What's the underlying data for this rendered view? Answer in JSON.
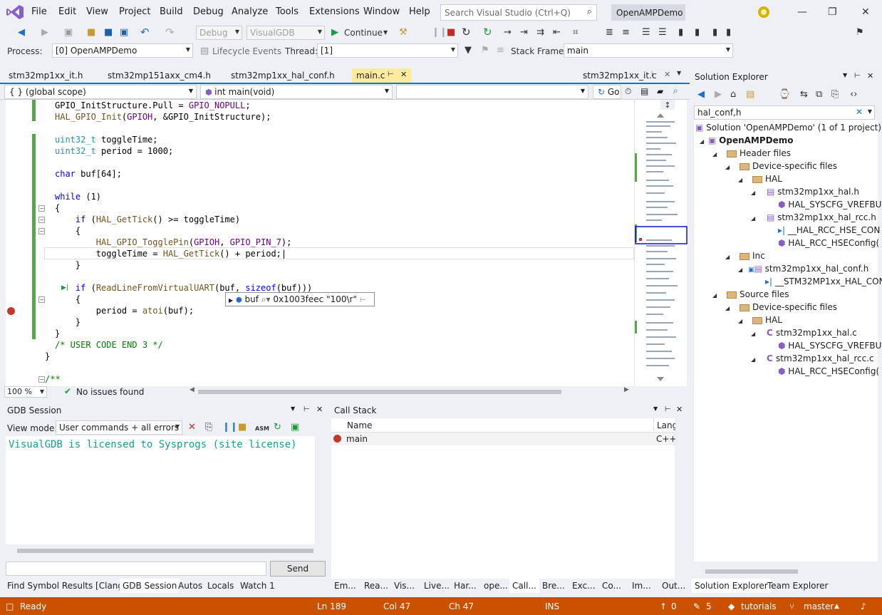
{
  "menu": {
    "items": [
      "File",
      "Edit",
      "View",
      "Project",
      "Build",
      "Debug",
      "Analyze",
      "Tools",
      "Extensions",
      "Window",
      "Help"
    ],
    "search_placeholder": "Search Visual Studio (Ctrl+Q)",
    "project_title": "OpenAMPDemo"
  },
  "toolbar": {
    "config": "Debug",
    "platform": "VisualGDB",
    "continue_label": "Continue",
    "process_label": "Process:",
    "process_value": "[0] OpenAMPDemo",
    "lifecycle_label": "Lifecycle Events",
    "thread_label": "Thread:",
    "thread_value": "[1]",
    "stackframe_label": "Stack Frame:",
    "stackframe_value": "main"
  },
  "editor": {
    "tabs": [
      "stm32mp1xx_it.h",
      "stm32mp151axx_cm4.h",
      "stm32mp1xx_hal_conf.h",
      "main.c",
      "stm32mp1xx_it.c"
    ],
    "active_tab": "main.c",
    "scope": "{ } (global scope)",
    "function": "int main(void)",
    "go_label": "Go",
    "zoom": "100 %",
    "issues": "No issues found",
    "datatip": {
      "name": "buf",
      "value": "0x1003feec \"100\\r\""
    }
  },
  "gdb": {
    "title": "GDB Session",
    "view_mode_label": "View mode:",
    "view_mode_value": "User commands + all errors",
    "output": "VisualGDB is licensed to Sysprogs (site license)",
    "send_label": "Send"
  },
  "bottom_left_tabs": [
    "Find Symbol Results [Clang]",
    "GDB Session",
    "Autos",
    "Locals",
    "Watch 1"
  ],
  "callstack": {
    "title": "Call Stack",
    "col_name": "Name",
    "col_lang": "Lang",
    "rows": [
      {
        "name": "main",
        "lang": "C++..."
      }
    ]
  },
  "bottom_right_tabs": [
    "Em...",
    "Rea...",
    "Vis...",
    "Live...",
    "Har...",
    "ope...",
    "Call...",
    "Bre...",
    "Exc...",
    "Co...",
    "Im...",
    "Out..."
  ],
  "solution_explorer": {
    "title": "Solution Explorer",
    "search_value": "hal_conf,h",
    "tabs": [
      "Solution Explorer",
      "Team Explorer"
    ],
    "tree": {
      "solution": "Solution 'OpenAMPDemo' (1 of 1 project)",
      "project": "OpenAMPDemo",
      "header_files": "Header files",
      "device_specific": "Device-specific files",
      "hal": "HAL",
      "f1": "stm32mp1xx_hal.h",
      "f1_child": "HAL_SYSCFG_VREFBUF",
      "f2": "stm32mp1xx_hal_rcc.h",
      "f2_child1": "__HAL_RCC_HSE_CON",
      "f2_child2": "HAL_RCC_HSEConfig(",
      "inc": "Inc",
      "f3": "stm32mp1xx_hal_conf.h",
      "f3_child": "__STM32MP1xx_HAL_CON",
      "source_files": "Source files",
      "device_specific2": "Device-specific files",
      "hal2": "HAL",
      "f4": "stm32mp1xx_hal.c",
      "f4_child": "HAL_SYSCFG_VREFBUF",
      "f5": "stm32mp1xx_hal_rcc.c",
      "f5_child": "HAL_RCC_HSEConfig("
    }
  },
  "status": {
    "ready": "Ready",
    "ln": "Ln 189",
    "col": "Col 47",
    "ch": "Ch 47",
    "ins": "INS",
    "up_count": "0",
    "edit_count": "5",
    "repo": "tutorials",
    "branch": "master"
  },
  "colors": {
    "accent": "#007acc",
    "statusbar": "#ca5100",
    "active_tab": "#ffeb9f"
  }
}
